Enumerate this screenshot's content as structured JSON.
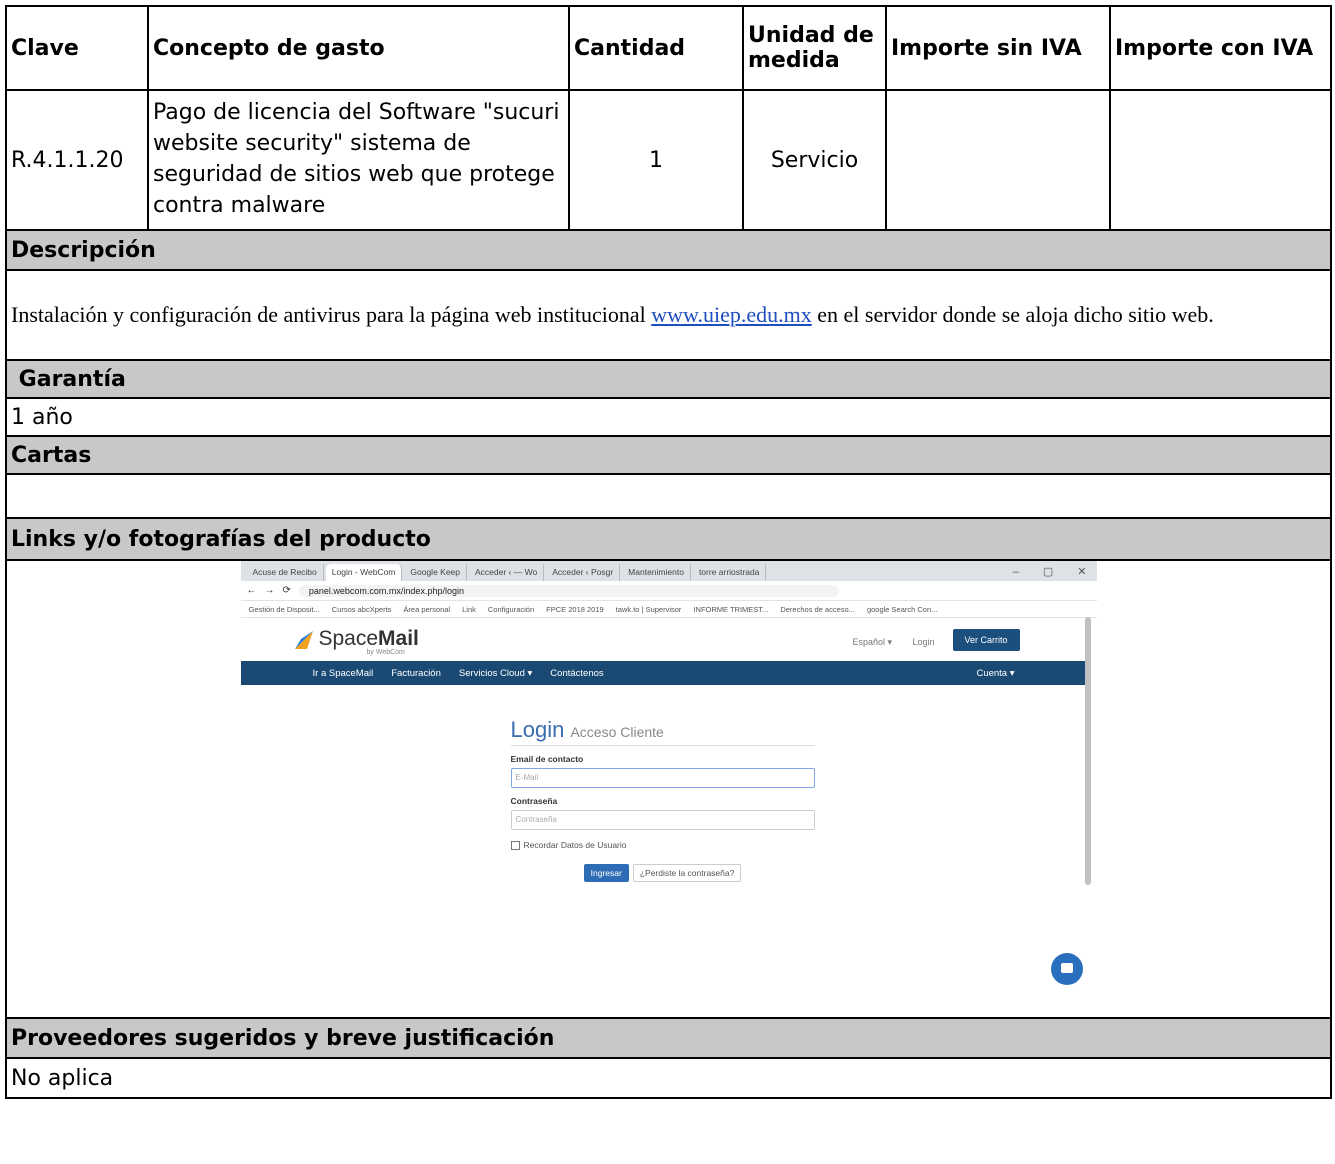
{
  "header": {
    "clave": "Clave",
    "concepto": "Concepto de gasto",
    "cantidad": "Cantidad",
    "unidad": "Unidad de medida",
    "importe_sin": "Importe sin IVA",
    "importe_con": "Importe con IVA"
  },
  "row": {
    "clave": "R.4.1.1.20",
    "concepto": "Pago de licencia del Software \"sucuri website security\" sistema de seguridad de sitios web que protege contra malware",
    "cantidad": "1",
    "unidad": "Servicio",
    "importe_sin": "",
    "importe_con": ""
  },
  "descripcion": {
    "label": "Descripción",
    "text_before": "Instalación y configuración de antivirus para la página web institucional ",
    "link": "www.uiep.edu.mx",
    "text_after": " en el servidor donde se aloja dicho sitio web."
  },
  "garantia": {
    "label": "Garantía",
    "value": "1 año"
  },
  "cartas": {
    "label": "Cartas",
    "value": ""
  },
  "links": {
    "label": "Links y/o fotografías del producto",
    "screenshot": {
      "tabs": [
        "Acuse de Recibo",
        "Login - WebCom",
        "Google Keep",
        "Acceder ‹ — Wo",
        "Acceder ‹ Posgr",
        "Mantenimiento",
        "torre arriostrada"
      ],
      "url": "panel.webcom.com.mx/index.php/login",
      "bookmarks": [
        "Gestión de Disposit...",
        "Cursos abcXperts",
        "Área personal",
        "Link",
        "Configuración",
        "FPCE 2018 2019",
        "tawk.to | Supervisor",
        "INFORME TRIMEST...",
        "Derechos de acceso...",
        "google Search Con..."
      ],
      "brand_a": "Space",
      "brand_b": "Mail",
      "brand_by": "by WebCom",
      "lang": "Español ▾",
      "login_link": "Login",
      "cart": "Ver Carrito",
      "nav": [
        "Ir a SpaceMail",
        "Facturación",
        "Servicios Cloud ▾",
        "Contáctenos"
      ],
      "account": "Cuenta ▾",
      "login_title": "Login",
      "login_sub": "Acceso Cliente",
      "email_label": "Email de contacto",
      "email_placeholder": "E-Mail",
      "pass_label": "Contraseña",
      "pass_placeholder": "Contraseña",
      "remember": "Recordar Datos de Usuario",
      "btn_login": "Ingresar",
      "btn_forgot": "¿Perdiste la contraseña?"
    }
  },
  "proveedores": {
    "label": "Proveedores sugeridos y breve justificación",
    "value": "No aplica"
  },
  "colors": {
    "section_gray": "#c8c8c8",
    "link": "#1f4ebf",
    "nav_blue": "#1a4a73"
  }
}
